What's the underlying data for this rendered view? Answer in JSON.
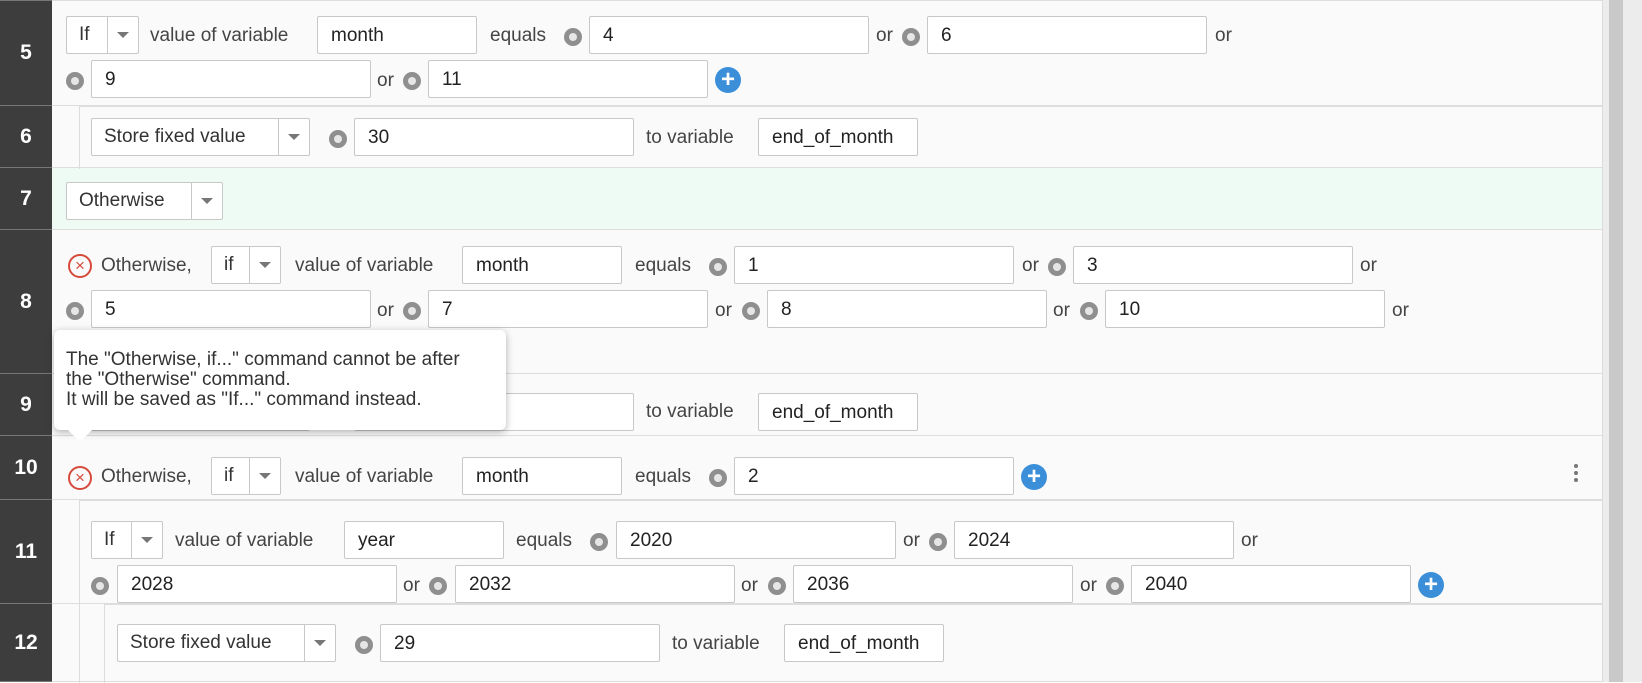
{
  "rows": {
    "r5": {
      "num": "5",
      "if_select": "If",
      "text_value_of_variable": "value of variable",
      "variable": "month",
      "text_equals": "equals",
      "values": [
        "4",
        "6",
        "9",
        "11"
      ],
      "or": "or"
    },
    "r6": {
      "num": "6",
      "action_select": "Store fixed value",
      "value": "30",
      "text_to_variable": "to variable",
      "target": "end_of_month"
    },
    "r7": {
      "num": "7",
      "otherwise_select": "Otherwise"
    },
    "r8": {
      "num": "8",
      "prefix": "Otherwise,",
      "if_select": "if",
      "text_value_of_variable": "value of variable",
      "variable": "month",
      "text_equals": "equals",
      "values": [
        "1",
        "3",
        "5",
        "7",
        "8",
        "10"
      ],
      "or": "or"
    },
    "r9": {
      "num": "9",
      "text_to_variable": "to variable",
      "target": "end_of_month"
    },
    "r10": {
      "num": "10",
      "prefix": "Otherwise,",
      "if_select": "if",
      "text_value_of_variable": "value of variable",
      "variable": "month",
      "text_equals": "equals",
      "values": [
        "2"
      ]
    },
    "r11": {
      "num": "11",
      "if_select": "If",
      "text_value_of_variable": "value of variable",
      "variable": "year",
      "text_equals": "equals",
      "values": [
        "2020",
        "2024",
        "2028",
        "2032",
        "2036",
        "2040"
      ],
      "or": "or"
    },
    "r12": {
      "num": "12",
      "action_select": "Store fixed value",
      "value": "29",
      "text_to_variable": "to variable",
      "target": "end_of_month"
    }
  },
  "tooltip": {
    "line1": "The \"Otherwise, if...\" command cannot be after",
    "line2": "the \"Otherwise\" command.",
    "line3": "It will be saved as \"If...\" command instead."
  },
  "colors": {
    "gutter": "#3d3d3d",
    "otherwise_row": "#eefaf4",
    "add_button": "#3a8fd8",
    "error_icon": "#d64a3b"
  },
  "icons": [
    "radio-icon",
    "add-circle-icon",
    "error-circle-icon",
    "chevron-down-icon",
    "kebab-menu-icon"
  ]
}
